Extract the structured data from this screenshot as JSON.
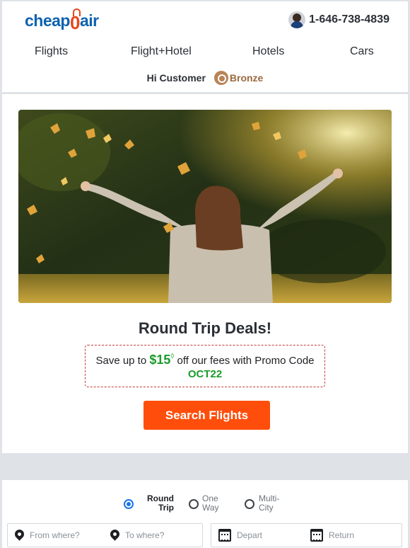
{
  "header": {
    "logo": {
      "part1": "cheap",
      "part2": "0",
      "part3": "air"
    },
    "phone": "1-646-738-4839"
  },
  "nav": {
    "items": [
      {
        "label": "Flights"
      },
      {
        "label": "Flight+Hotel"
      },
      {
        "label": "Hotels"
      },
      {
        "label": "Cars"
      }
    ]
  },
  "account": {
    "greeting": "Hi Customer",
    "tier": "Bronze"
  },
  "promo": {
    "headline": "Round Trip Deals!",
    "text_before": "Save up to ",
    "amount": "$15",
    "amount_mark": "◊",
    "text_after": " off our fees with Promo Code",
    "code": "OCT22",
    "button": "Search Flights"
  },
  "search": {
    "trip_types": [
      {
        "label": "Round Trip",
        "selected": true
      },
      {
        "label": "One Way",
        "selected": false
      },
      {
        "label": "Multi-City",
        "selected": false
      }
    ],
    "from_placeholder": "From where?",
    "to_placeholder": "To where?",
    "depart_placeholder": "Depart",
    "return_placeholder": "Return"
  },
  "colors": {
    "brand_blue": "#0d62b0",
    "brand_orange": "#e8471b",
    "cta": "#ff4e0b",
    "promo_green": "#1a9b2a",
    "radio_selected": "#1a73e8",
    "bronze": "#9a6a40"
  },
  "icons": [
    "agent-avatar",
    "bronze-tier-badge",
    "location-pin-icon",
    "calendar-icon",
    "radio-button"
  ]
}
